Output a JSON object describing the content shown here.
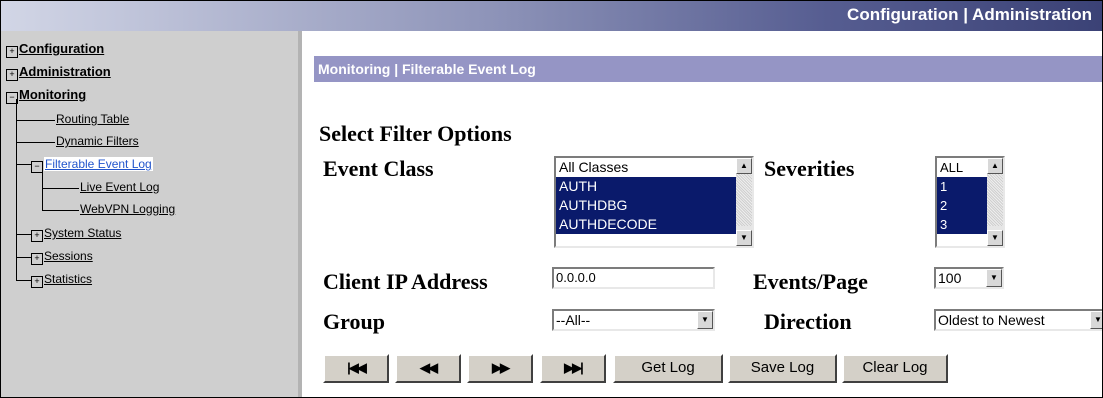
{
  "header": {
    "links": "Configuration | Administration"
  },
  "sidebar": {
    "configuration": "Configuration",
    "administration": "Administration",
    "monitoring": "Monitoring",
    "routing_table": "Routing Table",
    "dynamic_filters": "Dynamic Filters",
    "filterable_event_log": "Filterable Event Log",
    "live_event_log": "Live Event Log",
    "webvpn_logging": "WebVPN Logging",
    "system_status": "System Status",
    "sessions": "Sessions",
    "statistics": "Statistics"
  },
  "page": {
    "title": "Monitoring | Filterable Event Log",
    "heading": "Select Filter Options"
  },
  "form": {
    "event_class_label": "Event Class",
    "event_class_options": [
      "All Classes",
      "AUTH",
      "AUTHDBG",
      "AUTHDECODE"
    ],
    "severities_label": "Severities",
    "severity_options": [
      "ALL",
      "1",
      "2",
      "3"
    ],
    "client_ip_label": "Client IP Address",
    "client_ip_value": "0.0.0.0",
    "events_page_label": "Events/Page",
    "events_page_value": "100",
    "group_label": "Group",
    "group_value": "--All--",
    "direction_label": "Direction",
    "direction_value": "Oldest to Newest"
  },
  "buttons": {
    "first": "|◀◀",
    "prev": "◀◀",
    "next": "▶▶",
    "last": "▶▶|",
    "get_log": "Get Log",
    "save_log": "Save Log",
    "clear_log": "Clear Log"
  },
  "colors": {
    "title_bar": "#9595c5",
    "selection": "#0a1a6b",
    "sidebar_bg": "#cfcfcf",
    "highlight_link": "#2255cc"
  }
}
